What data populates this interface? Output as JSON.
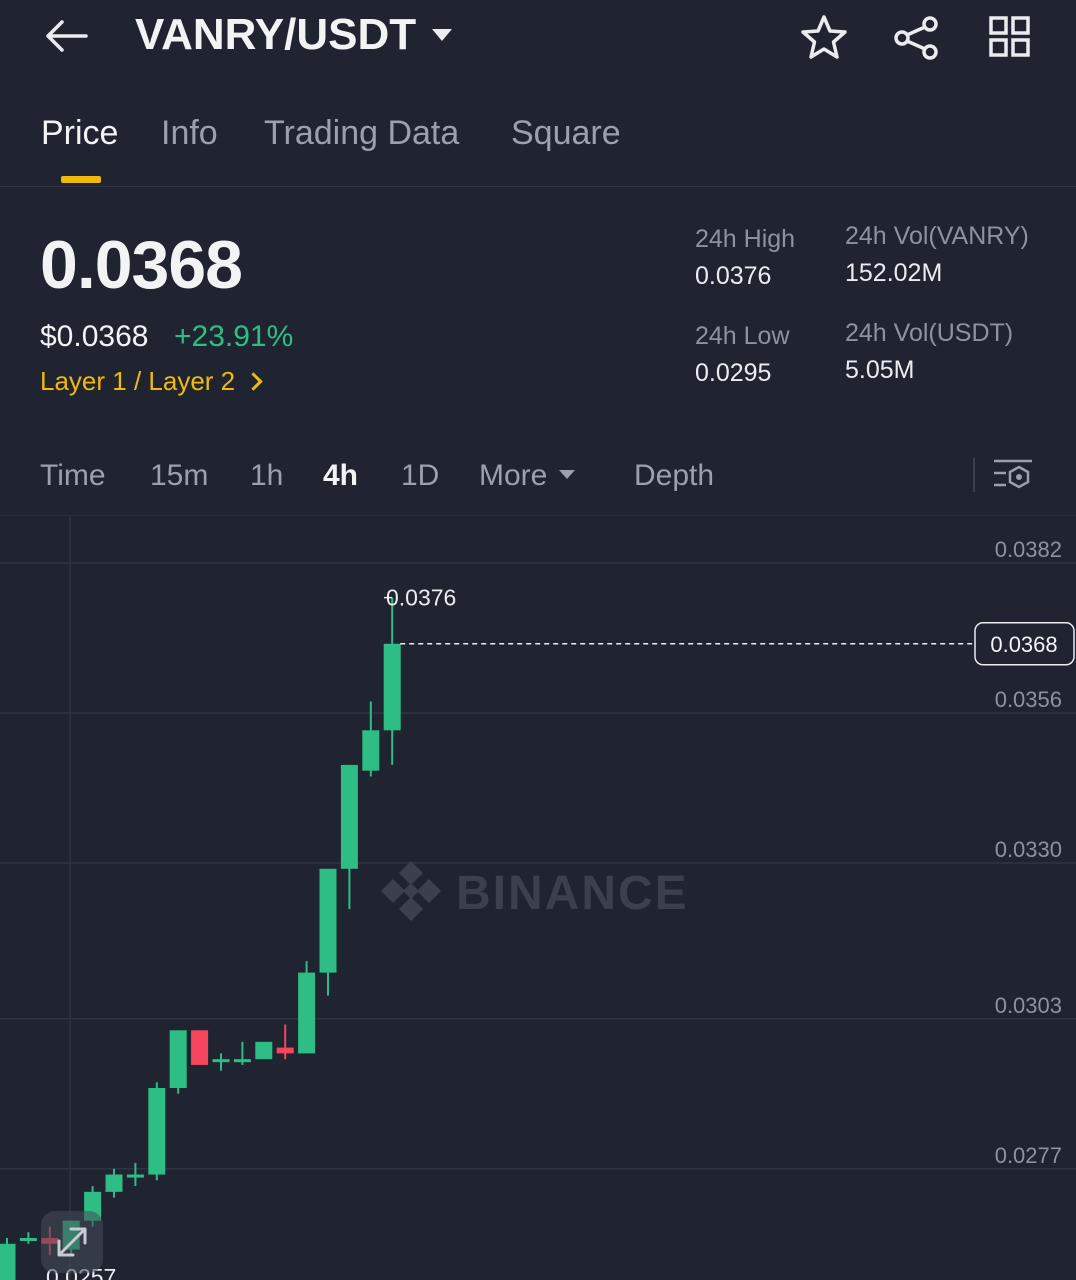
{
  "header": {
    "pair": "VANRY/USDT",
    "back_icon": "arrow-left-icon",
    "favorite_icon": "star-icon",
    "share_icon": "share-icon",
    "grid_icon": "grid-icon"
  },
  "tabs": [
    {
      "label": "Price",
      "active": true
    },
    {
      "label": "Info",
      "active": false
    },
    {
      "label": "Trading Data",
      "active": false
    },
    {
      "label": "Square",
      "active": false
    }
  ],
  "ticker": {
    "last_price": "0.0368",
    "usd_price": "$0.0368",
    "change_pct": "+23.91%",
    "category": "Layer 1 / Layer 2"
  },
  "stats": {
    "high_label": "24h High",
    "high_value": "0.0376",
    "low_label": "24h Low",
    "low_value": "0.0295",
    "vol_base_label": "24h Vol(VANRY)",
    "vol_base_value": "152.02M",
    "vol_quote_label": "24h Vol(USDT)",
    "vol_quote_value": "5.05M"
  },
  "intervals": {
    "time": "Time",
    "m15": "15m",
    "h1": "1h",
    "h4": "4h",
    "d1": "1D",
    "more": "More",
    "depth": "Depth",
    "active": "4h",
    "settings_icon": "chart-settings-icon"
  },
  "colors": {
    "up": "#2ebd85",
    "down": "#f6465d",
    "accent": "#f0b90b",
    "bg": "#1f2430"
  },
  "chart_data": {
    "type": "candlestick",
    "y_ticks": [
      "0.0382",
      "0.0356",
      "0.0330",
      "0.0303",
      "0.0277"
    ],
    "y_tick_values": [
      0.0382,
      0.0356,
      0.033,
      0.0303,
      0.0277
    ],
    "ylim": [
      0.0255,
      0.039
    ],
    "current_price": "0.0368",
    "high_marker": "0.0376",
    "low_marker": "0.0257",
    "watermark": "BINANCE",
    "candles": [
      {
        "o": 0.0257,
        "h": 0.0265,
        "l": 0.0255,
        "c": 0.0264
      },
      {
        "o": 0.0265,
        "h": 0.0266,
        "l": 0.0264,
        "c": 0.0265
      },
      {
        "o": 0.0265,
        "h": 0.0267,
        "l": 0.0262,
        "c": 0.0264
      },
      {
        "o": 0.0263,
        "h": 0.0268,
        "l": 0.0262,
        "c": 0.0268
      },
      {
        "o": 0.0268,
        "h": 0.0274,
        "l": 0.0267,
        "c": 0.0273
      },
      {
        "o": 0.0273,
        "h": 0.0277,
        "l": 0.0272,
        "c": 0.0276
      },
      {
        "o": 0.0276,
        "h": 0.0278,
        "l": 0.0274,
        "c": 0.0276
      },
      {
        "o": 0.0276,
        "h": 0.0292,
        "l": 0.0275,
        "c": 0.0291
      },
      {
        "o": 0.0291,
        "h": 0.0301,
        "l": 0.029,
        "c": 0.0301
      },
      {
        "o": 0.0301,
        "h": 0.0301,
        "l": 0.0295,
        "c": 0.0295
      },
      {
        "o": 0.0296,
        "h": 0.0297,
        "l": 0.0294,
        "c": 0.0296
      },
      {
        "o": 0.0296,
        "h": 0.0299,
        "l": 0.0295,
        "c": 0.0296
      },
      {
        "o": 0.0296,
        "h": 0.0299,
        "l": 0.0296,
        "c": 0.0299
      },
      {
        "o": 0.0298,
        "h": 0.0302,
        "l": 0.0296,
        "c": 0.0297
      },
      {
        "o": 0.0297,
        "h": 0.0313,
        "l": 0.0297,
        "c": 0.0311
      },
      {
        "o": 0.0311,
        "h": 0.0329,
        "l": 0.0307,
        "c": 0.0329
      },
      {
        "o": 0.0329,
        "h": 0.0347,
        "l": 0.0322,
        "c": 0.0347
      },
      {
        "o": 0.0346,
        "h": 0.0358,
        "l": 0.0345,
        "c": 0.0353
      },
      {
        "o": 0.0353,
        "h": 0.0376,
        "l": 0.0347,
        "c": 0.0368
      }
    ]
  }
}
